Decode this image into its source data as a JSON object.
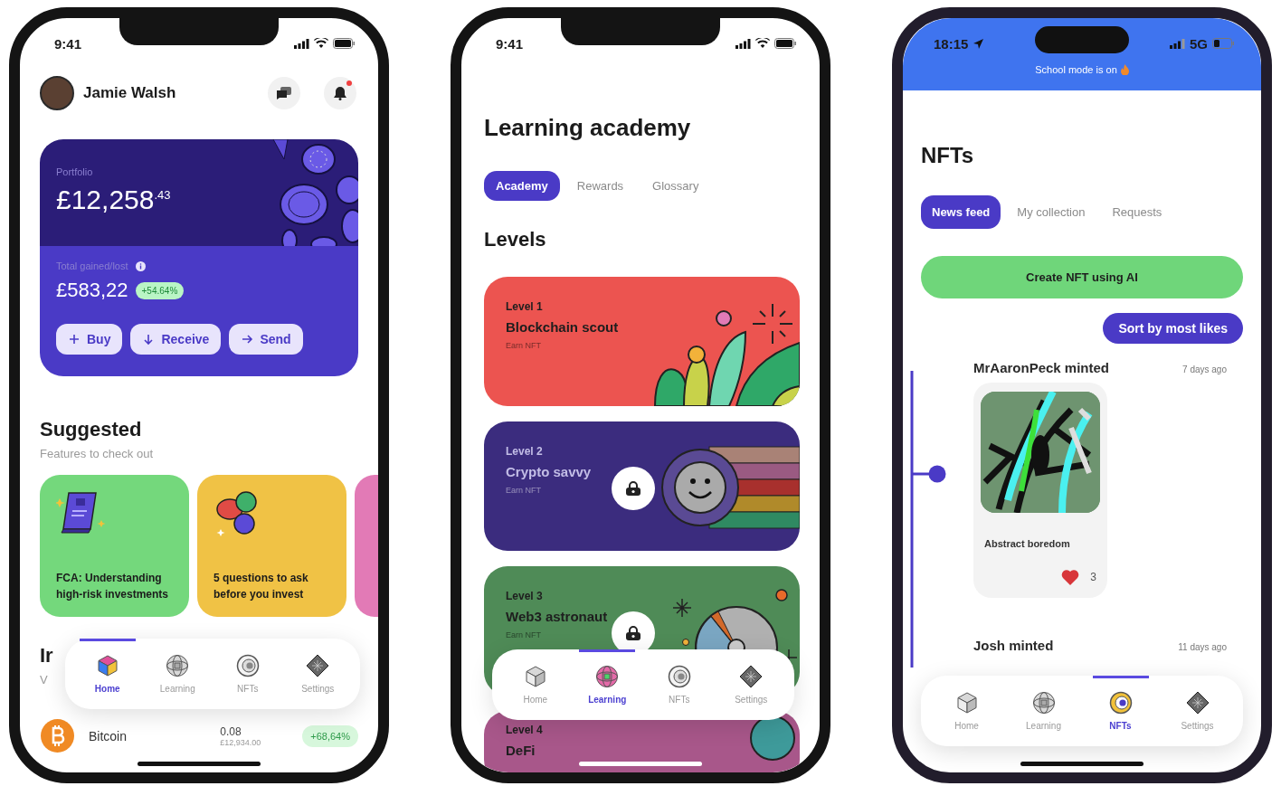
{
  "home_screen": {
    "frame": {
      "kind": "notch"
    },
    "status_bar": {
      "time": "9:41"
    },
    "profile": {
      "name": "Jamie Walsh",
      "notification": true
    },
    "portfolio": {
      "label": "Portfolio",
      "amount": "£12,258$^{.43}$",
      "gain_label": "Total gained/lost",
      "gain": "£583,22",
      "change": "+54.64%"
    },
    "actions": [
      {
        "kind": "buy",
        "label": "Buy"
      },
      {
        "kind": "receive",
        "label": "Receive"
      },
      {
        "kind": "send",
        "label": "Send"
      }
    ],
    "suggested": {
      "title": "Suggested",
      "subtitle": "Features to check out",
      "cards": [
        {
          "kind": "book",
          "text": "FCA: Understanding high-risk investments",
          "color": "#74d87c"
        },
        {
          "kind": "coins",
          "text": "5 questions to ask before you invest",
          "color": "#f0c245"
        },
        {
          "kind": "blank",
          "color": "#e27ab6"
        }
      ]
    },
    "investments": {
      "title": "Ir",
      "subtitle": "V",
      "rows": [
        {
          "name": "Bitcoin",
          "amount": "0.08",
          "value": "£12,934.00",
          "change": "+68,64%"
        }
      ]
    },
    "nav": [
      {
        "kind": "home",
        "label": "Home",
        "selected": true
      },
      {
        "kind": "learning",
        "label": "Learning",
        "selected": false
      },
      {
        "kind": "nfts",
        "label": "NFTs",
        "selected": false
      },
      {
        "kind": "settings",
        "label": "Settings",
        "selected": false
      }
    ]
  },
  "learning_screen": {
    "frame": {
      "kind": "notch"
    },
    "status_bar": {
      "time": "9:41"
    },
    "title": "Learning academy",
    "tabs": [
      {
        "label": "Academy",
        "selected": true
      },
      {
        "label": "Rewards",
        "selected": false
      },
      {
        "label": "Glossary",
        "selected": false
      }
    ],
    "section_title": "Levels",
    "levels": [
      {
        "level": "Level 1",
        "title": "Blockchain scout",
        "reward": "Earn NFT",
        "color": "#ec5450",
        "locked": false,
        "kind": "plants"
      },
      {
        "level": "Level 2",
        "title": "Crypto savvy",
        "reward": "Earn NFT",
        "color": "#3b2c7e",
        "locked": true,
        "kind": "smiley"
      },
      {
        "level": "Level 3",
        "title": "Web3 astronaut",
        "reward": "Earn NFT",
        "color": "#4f8b57",
        "locked": true,
        "kind": "pie"
      },
      {
        "level": "Level 4",
        "title": "DeFi",
        "color": "#a8578a",
        "locked": false,
        "kind": "bubble"
      }
    ],
    "nav": [
      {
        "kind": "home",
        "label": "Home",
        "selected": false
      },
      {
        "kind": "learning",
        "label": "Learning",
        "selected": true
      },
      {
        "kind": "nfts",
        "label": "NFTs",
        "selected": false
      },
      {
        "kind": "settings",
        "label": "Settings",
        "selected": false
      }
    ]
  },
  "nfts_screen": {
    "frame": {
      "kind": "island"
    },
    "status_bar": {
      "time": "18:15",
      "location": true,
      "network": "5G"
    },
    "banner": "School mode is on",
    "title": "NFTs",
    "tabs": [
      {
        "label": "News feed",
        "selected": true
      },
      {
        "label": "My collection",
        "selected": false
      },
      {
        "label": "Requests",
        "selected": false
      }
    ],
    "create_button": "Create NFT using AI",
    "sort_button": "Sort by most likes",
    "posts": [
      {
        "title": "MrAaronPeck minted",
        "time": "7 days ago",
        "nft": {
          "name": "Abstract boredom",
          "likes": "3",
          "liked": true
        }
      },
      {
        "title": "Josh minted",
        "time": "11 days ago"
      }
    ],
    "nav": [
      {
        "kind": "home",
        "label": "Home",
        "selected": false
      },
      {
        "kind": "learning",
        "label": "Learning",
        "selected": false
      },
      {
        "kind": "nfts",
        "label": "NFTs",
        "selected": true
      },
      {
        "kind": "settings",
        "label": "Settings",
        "selected": false
      }
    ]
  }
}
